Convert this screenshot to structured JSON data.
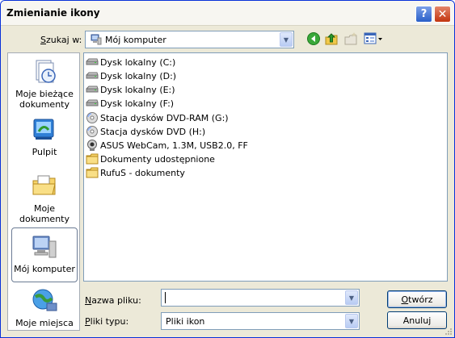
{
  "window": {
    "title": "Zmienianie ikony",
    "help_label": "?",
    "close_label": "✕"
  },
  "lookin": {
    "label_pre": "S",
    "label_rest": "zukaj w:",
    "value": "Mój komputer"
  },
  "places": [
    {
      "label": "Moje bieżące dokumenty"
    },
    {
      "label": "Pulpit"
    },
    {
      "label": "Moje dokumenty"
    },
    {
      "label": "Mój komputer"
    },
    {
      "label": "Moje miejsca"
    }
  ],
  "files": [
    {
      "label": "Dysk lokalny (C:)",
      "icon": "hard-drive-icon"
    },
    {
      "label": "Dysk lokalny (D:)",
      "icon": "hard-drive-icon"
    },
    {
      "label": "Dysk lokalny (E:)",
      "icon": "hard-drive-icon"
    },
    {
      "label": "Dysk lokalny (F:)",
      "icon": "hard-drive-icon"
    },
    {
      "label": "Stacja dysków DVD-RAM (G:)",
      "icon": "dvd-drive-icon"
    },
    {
      "label": "Stacja dysków DVD (H:)",
      "icon": "dvd-drive-icon"
    },
    {
      "label": "ASUS WebCam, 1.3M, USB2.0, FF",
      "icon": "webcam-icon"
    },
    {
      "label": "Dokumenty udostępnione",
      "icon": "folder-icon"
    },
    {
      "label": "RufuS - dokumenty",
      "icon": "folder-icon"
    }
  ],
  "filename": {
    "label_pre": "N",
    "label_rest": "azwa pliku:",
    "value": ""
  },
  "filetype": {
    "label_pre": "P",
    "label_rest": "liki typu:",
    "value": "Pliki ikon"
  },
  "buttons": {
    "open_pre": "O",
    "open_rest": "twórz",
    "cancel": "Anuluj"
  }
}
